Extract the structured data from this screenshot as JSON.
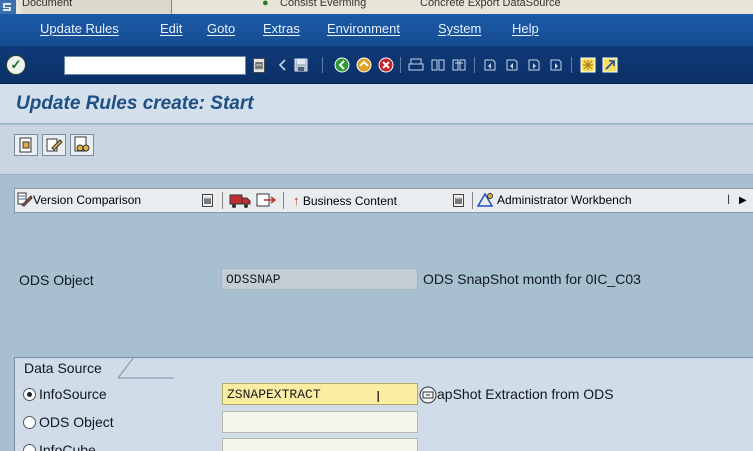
{
  "window_tabs": {
    "document_tab": "Document",
    "consist_evening": "Consist Everming",
    "concrete_export": "Concrete Export DataSource"
  },
  "menu": {
    "items": [
      "Update Rules",
      "Edit",
      "Goto",
      "Extras",
      "Environment",
      "System",
      "Help"
    ]
  },
  "command_field": {
    "value": ""
  },
  "title": "Update Rules create: Start",
  "content_toolbar": {
    "version_comparison": "Version Comparison",
    "business_content": "Business Content",
    "administrator_workbench": "Administrator Workbench"
  },
  "ods_object": {
    "label": "ODS Object",
    "value": "ODSSNAP",
    "description": "ODS SnapShot month for 0IC_C03"
  },
  "data_source": {
    "group_title": "Data Source",
    "options": [
      {
        "label": "InfoSource",
        "selected": true
      },
      {
        "label": "ODS Object",
        "selected": false
      },
      {
        "label": "InfoCube",
        "selected": false
      }
    ],
    "infosource_value": "ZSNAPEXTRACT",
    "infosource_description": "apShot Extraction from ODS"
  },
  "colors": {
    "menu_bar": "#1c5aa6",
    "std_toolbar": "#0f3a78",
    "background": "#a8bfd0",
    "title_text": "#1e4f85",
    "input_highlight": "#fbeea3"
  }
}
